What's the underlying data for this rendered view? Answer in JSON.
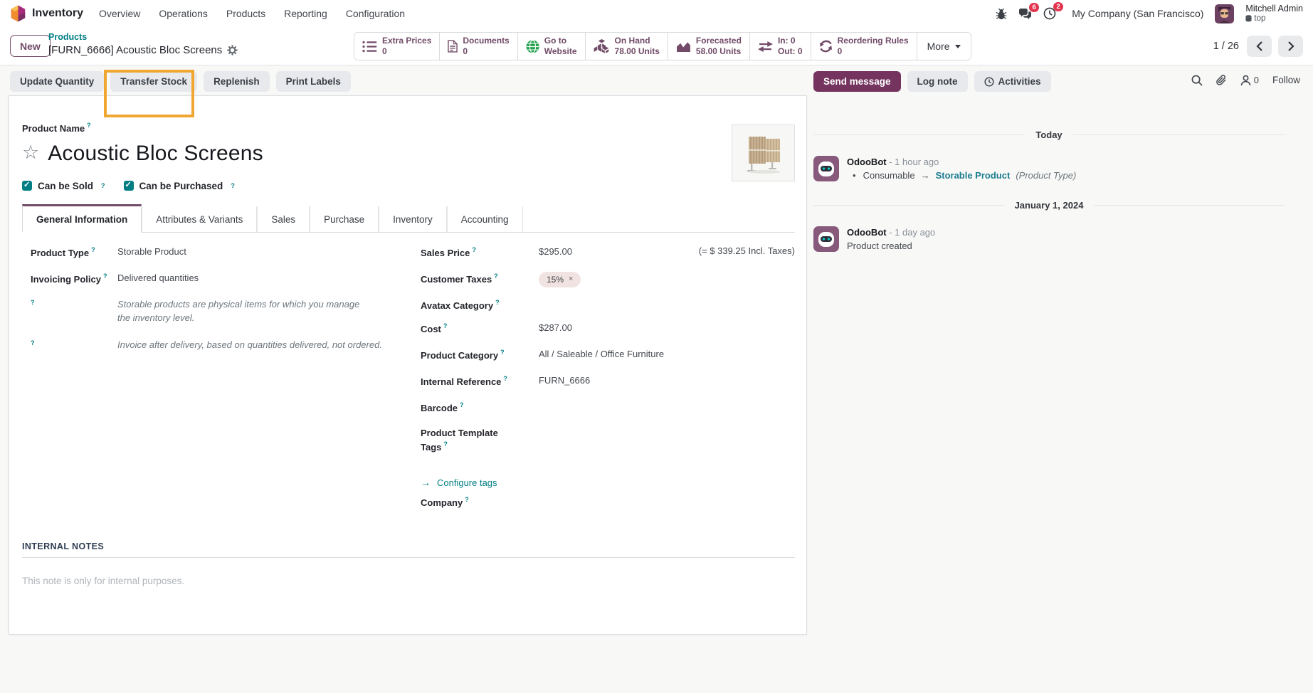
{
  "nav": {
    "app": "Inventory",
    "items": [
      "Overview",
      "Operations",
      "Products",
      "Reporting",
      "Configuration"
    ],
    "company": "My Company (San Francisco)",
    "user": {
      "name": "Mitchell Admin",
      "env": "top"
    },
    "badges": {
      "chat": "6",
      "activity": "2"
    }
  },
  "breadcrumb": {
    "new_label": "New",
    "parent": "Products",
    "current": "[FURN_6666] Acoustic Bloc Screens"
  },
  "stats": {
    "buttons": [
      {
        "icon": "list-icon",
        "label": "Extra Prices",
        "value": "0"
      },
      {
        "icon": "document-icon",
        "label": "Documents",
        "value": "0"
      },
      {
        "icon": "globe-icon",
        "label": "Go to",
        "value": "Website"
      },
      {
        "icon": "cubes-icon",
        "label": "On Hand",
        "value": "78.00 Units"
      },
      {
        "icon": "chart-icon",
        "label": "Forecasted",
        "value": "58.00 Units"
      },
      {
        "icon": "transfer-icon",
        "label": "In: 0",
        "value": "Out: 0"
      },
      {
        "icon": "refresh-icon",
        "label": "Reordering Rules",
        "value": "0"
      }
    ],
    "more": "More"
  },
  "pager": {
    "text": "1 / 26"
  },
  "actions": {
    "update_quantity": "Update Quantity",
    "transfer_stock": "Transfer Stock",
    "replenish": "Replenish",
    "print_labels": "Print Labels"
  },
  "form": {
    "name_label": "Product Name",
    "title": "Acoustic Bloc Screens",
    "checkboxes": [
      {
        "label": "Can be Sold",
        "checked": true
      },
      {
        "label": "Can be Purchased",
        "checked": true
      }
    ],
    "tabs": [
      "General Information",
      "Attributes & Variants",
      "Sales",
      "Purchase",
      "Inventory",
      "Accounting"
    ],
    "active_tab": "General Information",
    "left": {
      "product_type": {
        "label": "Product Type",
        "value": "Storable Product"
      },
      "invoicing_policy": {
        "label": "Invoicing Policy",
        "value": "Delivered quantities"
      },
      "type_help": "Storable products are physical items for which you manage the inventory level.",
      "policy_help": "Invoice after delivery, based on quantities delivered, not ordered."
    },
    "right": {
      "sales_price": {
        "label": "Sales Price",
        "value": "$295.00",
        "extra": "(= $ 339.25 Incl. Taxes)"
      },
      "customer_taxes": {
        "label": "Customer Taxes",
        "tag": "15%"
      },
      "avatax": {
        "label": "Avatax Category",
        "value": ""
      },
      "cost": {
        "label": "Cost",
        "value": "$287.00"
      },
      "category": {
        "label": "Product Category",
        "value": "All / Saleable / Office Furniture"
      },
      "internal_ref": {
        "label": "Internal Reference",
        "value": "FURN_6666"
      },
      "barcode": {
        "label": "Barcode",
        "value": ""
      },
      "template_tags": {
        "label": "Product Template Tags",
        "value": ""
      },
      "configure_tags": "Configure tags",
      "company": {
        "label": "Company",
        "value": ""
      }
    },
    "notes": {
      "header": "INTERNAL NOTES",
      "placeholder": "This note is only for internal purposes."
    }
  },
  "chatter": {
    "send_button": "Send message",
    "log_button": "Log note",
    "activities_button": "Activities",
    "follower_count": "0",
    "follow_label": "Follow",
    "today": {
      "date": "Today",
      "author": "OdooBot",
      "time": "- 1 hour ago",
      "change_from": "Consumable",
      "change_to": "Storable Product",
      "change_field": "(Product Type)"
    },
    "jan": {
      "date": "January 1, 2024",
      "author": "OdooBot",
      "time": "- 1 day ago",
      "body": "Product created"
    }
  },
  "colors": {
    "primary": "#714B67",
    "teal_link": "#017E84",
    "highlight": "#F0A732",
    "badge_red": "#E4354F",
    "globe_green": "#1FA04B"
  }
}
